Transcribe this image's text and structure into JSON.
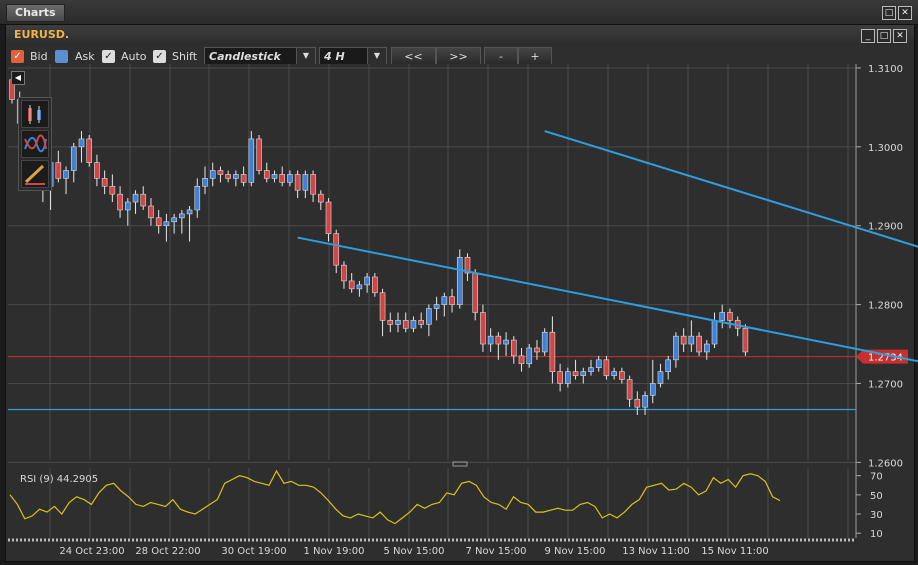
{
  "window": {
    "title": "Charts"
  },
  "chart_window": {
    "symbol": "EURUSD."
  },
  "toolbar": {
    "bid_label": "Bid",
    "ask_label": "Ask",
    "auto_label": "Auto",
    "shift_label": "Shift",
    "chart_type": "Candlestick",
    "timeframe": "4 H",
    "prev_label": "<<",
    "next_label": ">>",
    "zoom_out_label": "-",
    "zoom_in_label": "+"
  },
  "icons": [
    "candlestick-icon",
    "indicator-icon",
    "draw-tool-icon",
    "back-arrow-icon",
    "minimize-icon",
    "maximize-icon",
    "close-icon"
  ],
  "colors": {
    "bull": "#3f80d8",
    "bear": "#d04545",
    "trend": "#2aa0e0",
    "price_line": "#c63030",
    "rsi": "#d8c21a",
    "bg": "#2e2e2e",
    "grid": "#4a4a4a"
  },
  "rsi_label": "RSI (9)  44.2905",
  "chart_data": {
    "type": "candlestick",
    "y_ticks": [
      "1.3100",
      "1.3000",
      "1.2900",
      "1.2800",
      "1.2700",
      "1.2600"
    ],
    "ylim": [
      1.2603,
      1.3105
    ],
    "current_price": "1.2734",
    "horizontal_line": 1.2667,
    "x_ticks": [
      "24 Oct 23:00",
      "28 Oct 22:00",
      "30 Oct 19:00",
      "1 Nov 19:00",
      "5 Nov 15:00",
      "7 Nov 15:00",
      "9 Nov 15:00",
      "13 Nov 11:00",
      "15 Nov 11:00"
    ],
    "candles": [
      [
        1.3085,
        1.309,
        1.3055,
        1.306
      ],
      [
        1.306,
        1.307,
        1.302,
        1.303
      ],
      [
        1.303,
        1.304,
        1.3015,
        1.302
      ],
      [
        1.302,
        1.3025,
        1.3005,
        1.301
      ],
      [
        1.299,
        1.3,
        1.293,
        1.295
      ],
      [
        1.295,
        1.299,
        1.292,
        1.298
      ],
      [
        1.298,
        1.2995,
        1.2955,
        1.296
      ],
      [
        1.296,
        1.2975,
        1.294,
        1.297
      ],
      [
        1.297,
        1.3005,
        1.2955,
        1.3
      ],
      [
        1.3,
        1.302,
        1.298,
        1.301
      ],
      [
        1.301,
        1.3015,
        1.2975,
        1.298
      ],
      [
        1.298,
        1.299,
        1.295,
        1.296
      ],
      [
        1.296,
        1.297,
        1.294,
        1.295
      ],
      [
        1.295,
        1.2965,
        1.293,
        1.294
      ],
      [
        1.294,
        1.295,
        1.291,
        1.292
      ],
      [
        1.292,
        1.2935,
        1.29,
        1.293
      ],
      [
        1.293,
        1.2945,
        1.2915,
        1.294
      ],
      [
        1.294,
        1.295,
        1.292,
        1.2925
      ],
      [
        1.2925,
        1.2935,
        1.29,
        1.291
      ],
      [
        1.291,
        1.292,
        1.289,
        1.29
      ],
      [
        1.29,
        1.2915,
        1.288,
        1.2905
      ],
      [
        1.2905,
        1.2915,
        1.289,
        1.291
      ],
      [
        1.291,
        1.292,
        1.289,
        1.2915
      ],
      [
        1.2915,
        1.2925,
        1.288,
        1.292
      ],
      [
        1.292,
        1.296,
        1.291,
        1.295
      ],
      [
        1.295,
        1.2975,
        1.294,
        1.296
      ],
      [
        1.296,
        1.298,
        1.295,
        1.297
      ],
      [
        1.297,
        1.2975,
        1.2955,
        1.2965
      ],
      [
        1.2965,
        1.297,
        1.2955,
        1.296
      ],
      [
        1.296,
        1.297,
        1.295,
        1.2965
      ],
      [
        1.2965,
        1.2975,
        1.295,
        1.2955
      ],
      [
        1.2955,
        1.302,
        1.295,
        1.301
      ],
      [
        1.301,
        1.3015,
        1.2965,
        1.297
      ],
      [
        1.297,
        1.298,
        1.2955,
        1.296
      ],
      [
        1.296,
        1.297,
        1.2955,
        1.2965
      ],
      [
        1.2965,
        1.2975,
        1.295,
        1.2955
      ],
      [
        1.2955,
        1.297,
        1.295,
        1.2965
      ],
      [
        1.2965,
        1.297,
        1.2935,
        1.2945
      ],
      [
        1.2945,
        1.297,
        1.2935,
        1.2965
      ],
      [
        1.2965,
        1.297,
        1.293,
        1.294
      ],
      [
        1.294,
        1.2945,
        1.292,
        1.293
      ],
      [
        1.293,
        1.2935,
        1.288,
        1.289
      ],
      [
        1.289,
        1.2895,
        1.284,
        1.285
      ],
      [
        1.285,
        1.2855,
        1.282,
        1.283
      ],
      [
        1.283,
        1.284,
        1.2815,
        1.282
      ],
      [
        1.282,
        1.283,
        1.281,
        1.2825
      ],
      [
        1.2825,
        1.284,
        1.2815,
        1.2835
      ],
      [
        1.2835,
        1.284,
        1.281,
        1.2815
      ],
      [
        1.2815,
        1.282,
        1.276,
        1.278
      ],
      [
        1.278,
        1.279,
        1.2765,
        1.2775
      ],
      [
        1.2775,
        1.279,
        1.2765,
        1.278
      ],
      [
        1.278,
        1.279,
        1.2765,
        1.277
      ],
      [
        1.277,
        1.2785,
        1.2765,
        1.278
      ],
      [
        1.278,
        1.279,
        1.277,
        1.2775
      ],
      [
        1.2775,
        1.28,
        1.276,
        1.2795
      ],
      [
        1.2795,
        1.281,
        1.278,
        1.28
      ],
      [
        1.28,
        1.2815,
        1.2785,
        1.281
      ],
      [
        1.281,
        1.282,
        1.279,
        1.28
      ],
      [
        1.28,
        1.287,
        1.2795,
        1.286
      ],
      [
        1.286,
        1.2865,
        1.283,
        1.284
      ],
      [
        1.284,
        1.2845,
        1.278,
        1.279
      ],
      [
        1.279,
        1.28,
        1.274,
        1.275
      ],
      [
        1.275,
        1.277,
        1.274,
        1.276
      ],
      [
        1.276,
        1.2765,
        1.273,
        1.275
      ],
      [
        1.275,
        1.2765,
        1.2735,
        1.2755
      ],
      [
        1.2755,
        1.276,
        1.2725,
        1.2735
      ],
      [
        1.2735,
        1.2745,
        1.2715,
        1.2725
      ],
      [
        1.2725,
        1.275,
        1.272,
        1.2745
      ],
      [
        1.2745,
        1.2755,
        1.273,
        1.274
      ],
      [
        1.274,
        1.277,
        1.2735,
        1.2765
      ],
      [
        1.2765,
        1.2785,
        1.27,
        1.2715
      ],
      [
        1.2715,
        1.2725,
        1.269,
        1.27
      ],
      [
        1.27,
        1.272,
        1.2695,
        1.2715
      ],
      [
        1.2715,
        1.273,
        1.2705,
        1.271
      ],
      [
        1.271,
        1.272,
        1.27,
        1.2715
      ],
      [
        1.2715,
        1.273,
        1.271,
        1.272
      ],
      [
        1.272,
        1.2735,
        1.2715,
        1.273
      ],
      [
        1.273,
        1.2735,
        1.2705,
        1.271
      ],
      [
        1.271,
        1.272,
        1.2705,
        1.2715
      ],
      [
        1.2715,
        1.272,
        1.27,
        1.2705
      ],
      [
        1.2705,
        1.271,
        1.267,
        1.268
      ],
      [
        1.268,
        1.269,
        1.266,
        1.267
      ],
      [
        1.267,
        1.269,
        1.266,
        1.2685
      ],
      [
        1.2685,
        1.273,
        1.2675,
        1.27
      ],
      [
        1.27,
        1.2725,
        1.2695,
        1.2715
      ],
      [
        1.2715,
        1.2735,
        1.2705,
        1.273
      ],
      [
        1.273,
        1.2765,
        1.272,
        1.276
      ],
      [
        1.276,
        1.277,
        1.274,
        1.275
      ],
      [
        1.275,
        1.278,
        1.274,
        1.276
      ],
      [
        1.276,
        1.2765,
        1.2735,
        1.274
      ],
      [
        1.274,
        1.2755,
        1.273,
        1.275
      ],
      [
        1.275,
        1.279,
        1.2745,
        1.278
      ],
      [
        1.278,
        1.28,
        1.277,
        1.279
      ],
      [
        1.279,
        1.2795,
        1.277,
        1.278
      ],
      [
        1.278,
        1.2785,
        1.276,
        1.277
      ],
      [
        1.277,
        1.2775,
        1.2735,
        1.274
      ]
    ],
    "trend_lines": [
      {
        "x1": 69,
        "y1": 1.302,
        "x2": 168,
        "y2": 1.272
      },
      {
        "x1": 37,
        "y1": 1.2885,
        "x2": 160,
        "y2": 1.2645
      }
    ],
    "rsi": {
      "name": "RSI (9)",
      "value": 44.2905,
      "levels": [
        70,
        50,
        30,
        10
      ],
      "ylim": [
        5,
        78
      ],
      "values": [
        50,
        40,
        25,
        28,
        35,
        32,
        38,
        30,
        42,
        48,
        45,
        40,
        52,
        60,
        62,
        54,
        48,
        40,
        38,
        42,
        40,
        38,
        45,
        35,
        32,
        30,
        35,
        40,
        45,
        62,
        66,
        70,
        68,
        64,
        62,
        60,
        75,
        62,
        64,
        60,
        60,
        58,
        52,
        44,
        35,
        28,
        26,
        30,
        28,
        26,
        32,
        24,
        20,
        26,
        32,
        40,
        36,
        40,
        42,
        52,
        50,
        62,
        64,
        60,
        48,
        42,
        40,
        35,
        48,
        42,
        40,
        32,
        32,
        34,
        36,
        34,
        34,
        40,
        42,
        38,
        26,
        30,
        26,
        32,
        40,
        45,
        58,
        60,
        62,
        55,
        56,
        62,
        58,
        50,
        54,
        68,
        62,
        66,
        58,
        70,
        72,
        70,
        64,
        48,
        44
      ]
    }
  }
}
